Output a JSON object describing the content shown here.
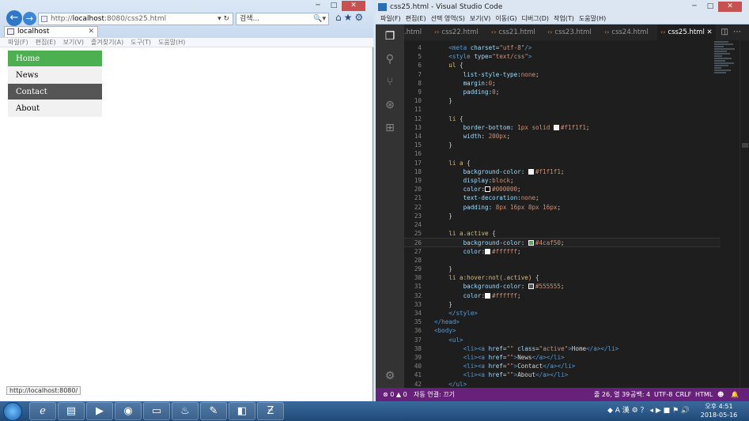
{
  "ie": {
    "url_prefix": "http://",
    "url_host": "localhost",
    "url_rest": ":8080/css25.html",
    "addr_buttons": "▾ ↻",
    "search_text": "검색...",
    "search_buttons": "🔍▾",
    "tab_label": "localhost",
    "tab_close": "✕",
    "menu": [
      "파일(F)",
      "편집(E)",
      "보기(V)",
      "즐겨찾기(A)",
      "도구(T)",
      "도움말(H)"
    ],
    "nav_items": [
      {
        "label": "Home",
        "state": "active"
      },
      {
        "label": "News",
        "state": "normal"
      },
      {
        "label": "Contact",
        "state": "hover"
      },
      {
        "label": "About",
        "state": "normal"
      }
    ],
    "status_url": "http://localhost:8080/"
  },
  "vscode": {
    "title": "css25.html - Visual Studio Code",
    "menu": [
      "파일(F)",
      "편집(E)",
      "선택 영역(S)",
      "보기(V)",
      "이동(G)",
      "디버그(D)",
      "작업(T)",
      "도움말(H)"
    ],
    "tabs": [
      ".html",
      "css22.html",
      "css21.html",
      "css23.html",
      "css24.html",
      "css25.html"
    ],
    "active_tab": "css25.html",
    "code_lines": [
      {
        "n": "4",
        "html": "    <span class='t'>&lt;meta</span> <span class='a'>charset</span><span class='p'>=</span><span class='s'>\"utf-8\"</span><span class='t'>/&gt;</span>"
      },
      {
        "n": "5",
        "html": "    <span class='t'>&lt;style</span> <span class='a'>type</span><span class='p'>=</span><span class='s'>\"text/css\"</span><span class='t'>&gt;</span>"
      },
      {
        "n": "6",
        "html": "    <span class='sel'>ul</span> <span class='p'>{</span>"
      },
      {
        "n": "7",
        "html": "        <span class='k'>list-style-type</span><span class='p'>:</span><span class='v'>none</span><span class='p'>;</span>"
      },
      {
        "n": "8",
        "html": "        <span class='k'>margin</span><span class='p'>:</span><span class='v'>0</span><span class='p'>;</span>"
      },
      {
        "n": "9",
        "html": "        <span class='k'>padding</span><span class='p'>:</span><span class='v'>0</span><span class='p'>;</span>"
      },
      {
        "n": "10",
        "html": "    <span class='p'>}</span>"
      },
      {
        "n": "11",
        "html": ""
      },
      {
        "n": "12",
        "html": "    <span class='sel'>li</span> <span class='p'>{</span>"
      },
      {
        "n": "13",
        "html": "        <span class='k'>border-bottom</span><span class='p'>:</span> <span class='v'>1px</span> <span class='v'>solid</span> <span class='sw' style='background:#f1f1f1'></span><span class='v'>#f1f1f1</span><span class='p'>;</span>"
      },
      {
        "n": "14",
        "html": "        <span class='k'>width</span><span class='p'>:</span> <span class='v'>200px</span><span class='p'>;</span>"
      },
      {
        "n": "15",
        "html": "    <span class='p'>}</span>"
      },
      {
        "n": "16",
        "html": ""
      },
      {
        "n": "17",
        "html": "    <span class='sel'>li a</span> <span class='p'>{</span>"
      },
      {
        "n": "18",
        "html": "        <span class='k'>background-color</span><span class='p'>:</span> <span class='sw' style='background:#f1f1f1'></span><span class='v'>#f1f1f1</span><span class='p'>;</span>"
      },
      {
        "n": "19",
        "html": "        <span class='k'>display</span><span class='p'>:</span><span class='v'>block</span><span class='p'>;</span>"
      },
      {
        "n": "20",
        "html": "        <span class='k'>color</span><span class='p'>:</span><span class='sw' style='background:#000000'></span><span class='v'>#000000</span><span class='p'>;</span>"
      },
      {
        "n": "21",
        "html": "        <span class='k'>text-decoration</span><span class='p'>:</span><span class='v'>none</span><span class='p'>;</span>"
      },
      {
        "n": "22",
        "html": "        <span class='k'>padding</span><span class='p'>:</span> <span class='v'>8px 16px 8px 16px</span><span class='p'>;</span>"
      },
      {
        "n": "23",
        "html": "    <span class='p'>}</span>"
      },
      {
        "n": "24",
        "html": ""
      },
      {
        "n": "25",
        "html": "    <span class='sel'>li a.active</span> <span class='p'>{</span>"
      },
      {
        "n": "26",
        "html": "        <span class='k'>background-color</span><span class='p'>:</span> <span class='sw' style='background:#4caf50'></span><span class='v'>#4caf50</span><span class='p'>;</span>",
        "current": true
      },
      {
        "n": "27",
        "html": "        <span class='k'>color</span><span class='p'>:</span><span class='sw' style='background:#ffffff'></span><span class='v'>#ffffff</span><span class='p'>;</span>"
      },
      {
        "n": "28",
        "html": ""
      },
      {
        "n": "29",
        "html": "    <span class='p'>}</span>"
      },
      {
        "n": "30",
        "html": "    <span class='sel'>li a:hover:not(.active)</span> <span class='p'>{</span>"
      },
      {
        "n": "31",
        "html": "        <span class='k'>background-color</span><span class='p'>:</span> <span class='sw' style='background:#555555'></span><span class='v'>#555555</span><span class='p'>;</span>"
      },
      {
        "n": "32",
        "html": "        <span class='k'>color</span><span class='p'>:</span><span class='sw' style='background:#ffffff'></span><span class='v'>#ffffff</span><span class='p'>;</span>"
      },
      {
        "n": "33",
        "html": "    <span class='p'>}</span>"
      },
      {
        "n": "34",
        "html": "    <span class='t'>&lt;/style&gt;</span>"
      },
      {
        "n": "35",
        "html": "<span class='t'>&lt;/head&gt;</span>"
      },
      {
        "n": "36",
        "html": "<span class='t'>&lt;body&gt;</span>"
      },
      {
        "n": "37",
        "html": "    <span class='t'>&lt;ul&gt;</span>"
      },
      {
        "n": "38",
        "html": "        <span class='t'>&lt;li&gt;&lt;a</span> <span class='a'>href</span><span class='p'>=</span><span class='s'>\"\"</span> <span class='a'>class</span><span class='p'>=</span><span class='s'>\"active\"</span><span class='t'>&gt;</span><span class='p'>Home</span><span class='t'>&lt;/a&gt;&lt;/li&gt;</span>"
      },
      {
        "n": "39",
        "html": "        <span class='t'>&lt;li&gt;&lt;a</span> <span class='a'>href</span><span class='p'>=</span><span class='s'>\"\"</span><span class='t'>&gt;</span><span class='p'>News</span><span class='t'>&lt;/a&gt;&lt;/li&gt;</span>"
      },
      {
        "n": "40",
        "html": "        <span class='t'>&lt;li&gt;&lt;a</span> <span class='a'>href</span><span class='p'>=</span><span class='s'>\"\"</span><span class='t'>&gt;</span><span class='p'>Contact</span><span class='t'>&lt;/a&gt;&lt;/li&gt;</span>"
      },
      {
        "n": "41",
        "html": "        <span class='t'>&lt;li&gt;&lt;a</span> <span class='a'>href</span><span class='p'>=</span><span class='s'>\"\"</span><span class='t'>&gt;</span><span class='p'>About</span><span class='t'>&lt;/a&gt;&lt;/li&gt;</span>"
      },
      {
        "n": "42",
        "html": "    <span class='t'>&lt;/ul&gt;</span>"
      }
    ],
    "status": {
      "problems": "⊗ 0 ▲ 0",
      "auto_connect": "자동 연결: 끄기",
      "position": "줄 26, 열 39",
      "spaces": "공백: 4",
      "encoding": "UTF-8",
      "eol": "CRLF",
      "language": "HTML",
      "smiley": "☻",
      "bell": "🔔"
    }
  },
  "taskbar": {
    "tray_text": "◆ A 漢 ⚙ ？ ◂ ▶ ■ ⚑ 🔊",
    "time": "오후 4:51",
    "date": "2018-05-16"
  },
  "colors": {
    "active_bg": "#4caf50",
    "hover_bg": "#555555",
    "item_bg": "#f1f1f1",
    "vscode_status": "#68217a"
  }
}
